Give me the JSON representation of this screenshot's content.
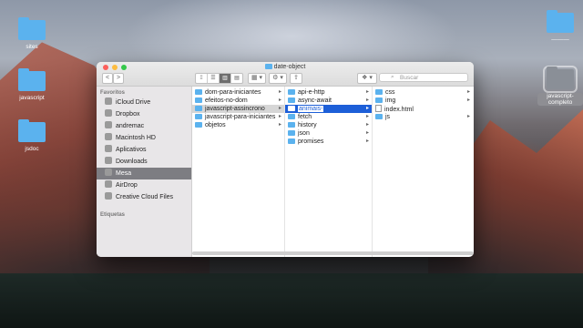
{
  "window": {
    "title": "date-object",
    "search_placeholder": "Buscar",
    "nav": {
      "back": "<",
      "forward": ">"
    },
    "view_modes": [
      "⁞⁞",
      "☰",
      "▥",
      "▤"
    ],
    "active_view": 2,
    "arrange": "▦ ▾",
    "action": "⚙ ▾",
    "share": "⇪",
    "dropbox": "❖ ▾"
  },
  "sidebar": {
    "favorites_heading": "Favoritos",
    "favorites": [
      {
        "label": "iCloud Drive",
        "icon": "cloud-icon"
      },
      {
        "label": "Dropbox",
        "icon": "dropbox-icon"
      },
      {
        "label": "andremac",
        "icon": "home-icon"
      },
      {
        "label": "Macintosh HD",
        "icon": "disk-icon"
      },
      {
        "label": "Aplicativos",
        "icon": "apps-icon"
      },
      {
        "label": "Downloads",
        "icon": "download-icon"
      },
      {
        "label": "Mesa",
        "icon": "desktop-icon",
        "active": true
      },
      {
        "label": "AirDrop",
        "icon": "airdrop-icon"
      },
      {
        "label": "Creative Cloud Files",
        "icon": "creative-cloud-icon"
      }
    ],
    "tags_heading": "Etiquetas"
  },
  "columns": [
    {
      "items": [
        {
          "name": "dom-para-iniciantes",
          "type": "folder"
        },
        {
          "name": "efeitos-no-dom",
          "type": "folder"
        },
        {
          "name": "javascript-assincrono",
          "type": "folder",
          "state": "highlighted"
        },
        {
          "name": "javascript-para-iniciantes",
          "type": "folder"
        },
        {
          "name": "objetos",
          "type": "folder"
        }
      ]
    },
    {
      "items": [
        {
          "name": "api-e-http",
          "type": "folder"
        },
        {
          "name": "async-await",
          "type": "folder"
        },
        {
          "name": "animais-",
          "type": "folder",
          "state": "editing"
        },
        {
          "name": "fetch",
          "type": "folder"
        },
        {
          "name": "history",
          "type": "folder"
        },
        {
          "name": "json",
          "type": "folder"
        },
        {
          "name": "promises",
          "type": "folder"
        }
      ]
    },
    {
      "items": [
        {
          "name": "css",
          "type": "folder"
        },
        {
          "name": "img",
          "type": "folder"
        },
        {
          "name": "index.html",
          "type": "file"
        },
        {
          "name": "js",
          "type": "folder"
        }
      ]
    }
  ],
  "desktop": {
    "left_icons": [
      "sites",
      "javascript",
      "jsdoc"
    ],
    "right_icons": [
      {
        "label": "———",
        "selected": false
      },
      {
        "label": "javascript-\ncompleto",
        "selected": true
      }
    ]
  },
  "colors": {
    "selection": "#1d5fd8",
    "folder": "#5bb2ee"
  }
}
